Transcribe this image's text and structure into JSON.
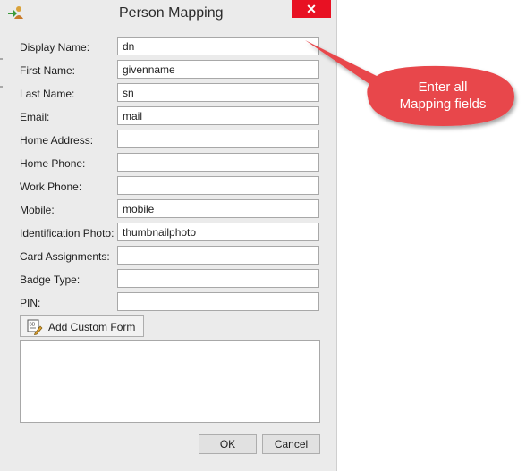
{
  "dialog": {
    "title": "Person Mapping",
    "close_label": "✕"
  },
  "fields": [
    {
      "label": "Display Name:",
      "value": "dn"
    },
    {
      "label": "First Name:",
      "value": "givenname"
    },
    {
      "label": "Last Name:",
      "value": "sn"
    },
    {
      "label": "Email:",
      "value": "mail"
    },
    {
      "label": "Home Address:",
      "value": ""
    },
    {
      "label": "Home Phone:",
      "value": ""
    },
    {
      "label": "Work Phone:",
      "value": ""
    },
    {
      "label": "Mobile:",
      "value": "mobile"
    },
    {
      "label": "Identification Photo:",
      "value": "thumbnailphoto"
    },
    {
      "label": "Card Assignments:",
      "value": ""
    },
    {
      "label": "Badge Type:",
      "value": ""
    },
    {
      "label": "PIN:",
      "value": ""
    }
  ],
  "custom_form": {
    "button_label": "Add Custom Form"
  },
  "buttons": {
    "ok_label": "OK",
    "cancel_label": "Cancel"
  },
  "callout": {
    "line1": "Enter all",
    "line2": "Mapping fields",
    "color": "#e8474c"
  },
  "colors": {
    "dialog_bg": "#ebebeb",
    "close_button": "#e81123"
  },
  "icons": {
    "title": "person-mapping-icon",
    "custom_form": "form-edit-icon"
  }
}
